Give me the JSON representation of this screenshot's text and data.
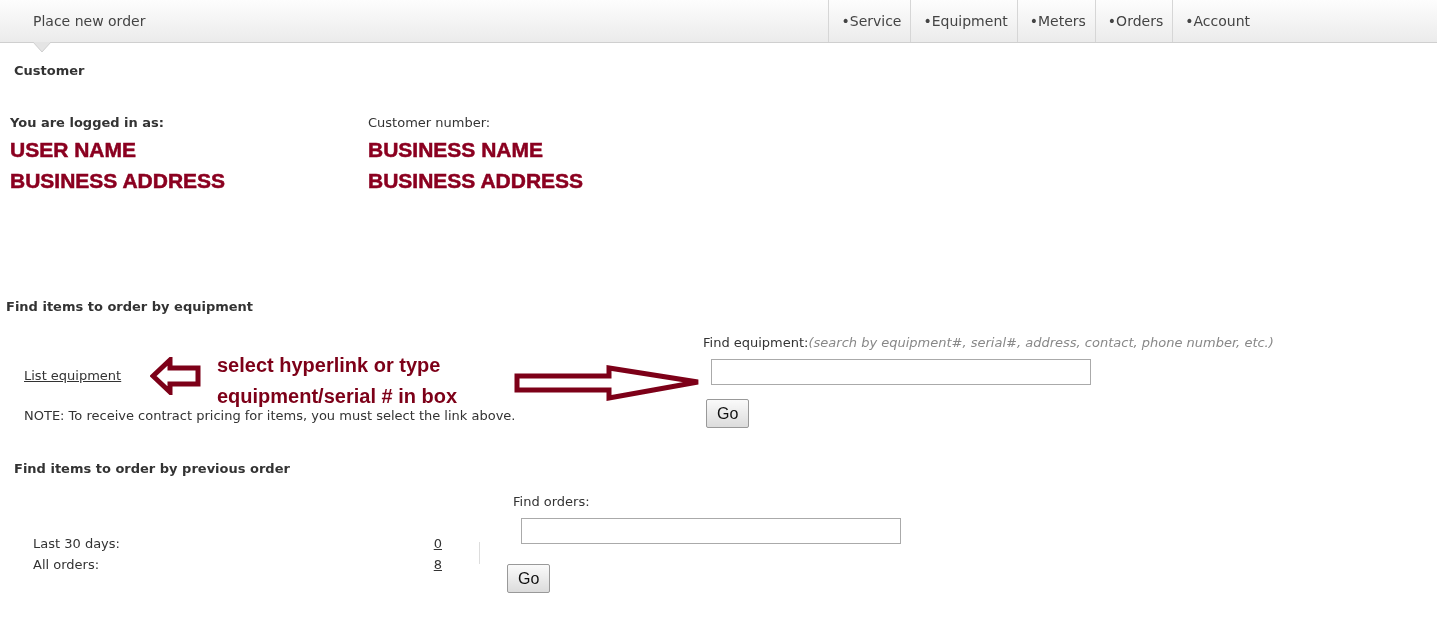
{
  "breadcrumb": {
    "label": "Place new order"
  },
  "nav": [
    {
      "label": "•Service"
    },
    {
      "label": "•Equipment"
    },
    {
      "label": "•Meters"
    },
    {
      "label": "•Orders"
    },
    {
      "label": "•Account"
    }
  ],
  "section_title": "Customer",
  "logged_in": {
    "label": "You are logged in as:",
    "lines": [
      "USER NAME",
      "BUSINESS ADDRESS"
    ]
  },
  "customer": {
    "label": "Customer number:",
    "lines": [
      "BUSINESS NAME",
      "BUSINESS ADDRESS"
    ]
  },
  "equipment_search": {
    "title": "Find items to order by equipment",
    "link": "List equipment",
    "note": "NOTE: To receive contract pricing for items, you must select the link above.",
    "annotation": [
      "select hyperlink or type",
      "equipment/serial # in box"
    ],
    "field_label": "Find equipment:",
    "hint": "(search by equipment#, serial#, address, contact, phone number, etc.)",
    "button": "Go"
  },
  "order_search": {
    "title": "Find items to order by previous order",
    "rows": [
      {
        "label": "Last 30 days:",
        "count": "0"
      },
      {
        "label": "All orders:",
        "count": "8"
      }
    ],
    "field_label": "Find orders:",
    "button": "Go"
  }
}
